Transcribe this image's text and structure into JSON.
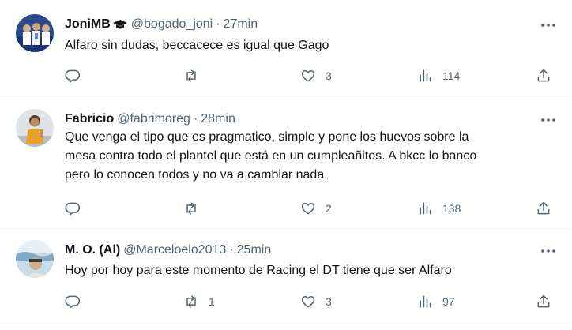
{
  "tweets": [
    {
      "name": "JoniMB",
      "handle": "@bogado_joni",
      "separator": "·",
      "time": "27min",
      "text": "Alfaro sin dudas, beccacece es igual que Gago",
      "reply_count": "",
      "retweet_count": "",
      "like_count": "3",
      "views_count": "114",
      "name_badge_icon": "graduation-cap-icon",
      "avatar_colors": [
        "#1a3f8f",
        "#6e8fd1"
      ]
    },
    {
      "name": "Fabricio",
      "handle": "@fabrimoreg",
      "separator": "·",
      "time": "28min",
      "text": "Que venga el tipo que es pragmatico, simple y pone los huevos sobre la\nmesa contra todo el plantel que está en un cumpleañitos. A bkcc lo banco\npero lo conocen todos y no va a cambiar nada.",
      "reply_count": "",
      "retweet_count": "",
      "like_count": "2",
      "views_count": "138",
      "avatar_colors": [
        "#d9dde0",
        "#e8a32c"
      ]
    },
    {
      "name": "M. O. (Al)",
      "handle": "@Marceloelo2013",
      "separator": "·",
      "time": "25min",
      "text": "Hoy por hoy para este momento de Racing el DT tiene que ser Alfaro",
      "reply_count": "",
      "retweet_count": "1",
      "like_count": "3",
      "views_count": "97",
      "avatar_colors": [
        "#b9d4e6",
        "#c9a98a"
      ]
    }
  ],
  "icons": {
    "reply": "reply-icon",
    "retweet": "retweet-icon",
    "like": "heart-icon",
    "views": "views-icon",
    "share": "share-icon",
    "more": "more-icon"
  },
  "colors": {
    "text": "#0f1419",
    "secondary": "#536471",
    "divider": "#eff3f4"
  }
}
